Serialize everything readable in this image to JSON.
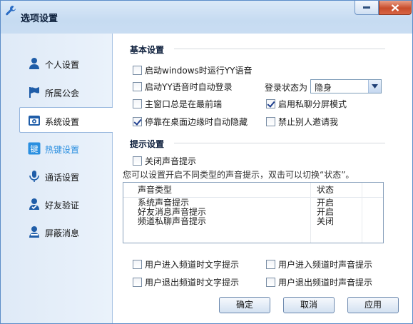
{
  "window": {
    "title": "选项设置",
    "icon": "wrench-icon"
  },
  "sidebar": {
    "items": [
      {
        "label": "个人设置",
        "icon": "person-icon"
      },
      {
        "label": "所属公会",
        "icon": "flag-icon"
      },
      {
        "label": "系统设置",
        "icon": "system-icon",
        "active": true
      },
      {
        "label": "热键设置",
        "icon": "hotkey-icon"
      },
      {
        "label": "通话设置",
        "icon": "microphone-icon"
      },
      {
        "label": "好友验证",
        "icon": "friend-verify-icon"
      },
      {
        "label": "屏蔽消息",
        "icon": "block-message-icon"
      }
    ]
  },
  "basic": {
    "title": "基本设置",
    "startup_windows": {
      "label": "启动windows时运行YY语音",
      "checked": false
    },
    "auto_login": {
      "label": "启动YY语音时自动登录",
      "checked": false
    },
    "always_top": {
      "label": "主窗口总是在最前端",
      "checked": false
    },
    "auto_hide": {
      "label": "停靠在桌面边缘时自动隐藏",
      "checked": true
    },
    "login_status_label": "登录状态为",
    "login_status_value": "隐身",
    "private_split": {
      "label": "启用私聊分屏模式",
      "checked": true
    },
    "no_invite": {
      "label": "禁止别人邀请我",
      "checked": false
    }
  },
  "prompt": {
    "title": "提示设置",
    "close_sound": {
      "label": "关闭声音提示",
      "checked": false
    },
    "hint": "您可以设置开启不同类型的声音提示，双击可以切换“状态”。",
    "table": {
      "headers": [
        "声音类型",
        "状态"
      ],
      "rows": [
        [
          "系统声音提示",
          "开启"
        ],
        [
          "好友消息声音提示",
          "开启"
        ],
        [
          "频道私聊声音提示",
          "关闭"
        ]
      ]
    },
    "enter_text": {
      "label": "用户进入频道时文字提示",
      "checked": false
    },
    "enter_sound": {
      "label": "用户进入频道时声音提示",
      "checked": false
    },
    "leave_text": {
      "label": "用户退出频道时文字提示",
      "checked": false
    },
    "leave_sound": {
      "label": "用户退出频道时声音提示",
      "checked": false
    }
  },
  "buttons": {
    "ok": "确定",
    "cancel": "取消",
    "apply": "应用"
  },
  "colors": {
    "accent": "#2a8fe0",
    "titlebar": "#c6dbf1",
    "close": "#c84d2c"
  }
}
